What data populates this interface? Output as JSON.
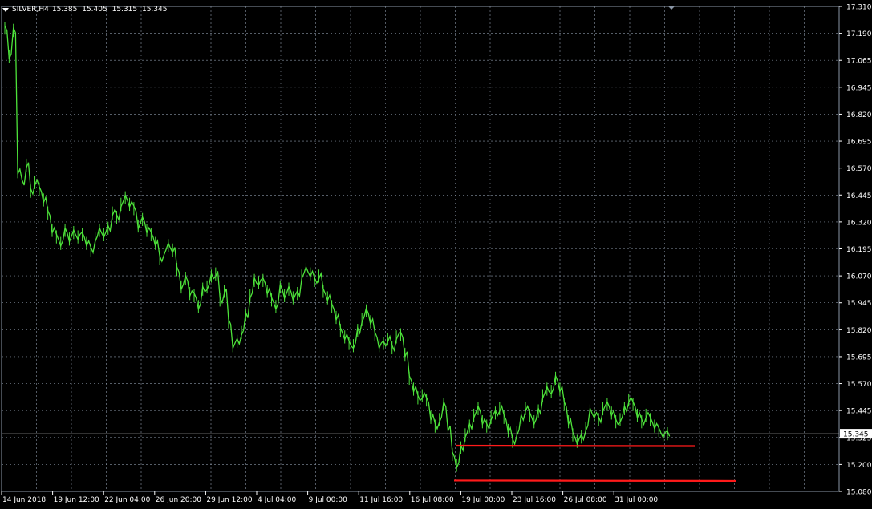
{
  "header": {
    "symbol": "SILVER,H4",
    "open": "15.385",
    "high": "15.405",
    "low": "15.315",
    "close": "15.345"
  },
  "colors": {
    "background": "#000000",
    "grid": "#8a96a6",
    "candle": "#4de33a",
    "text": "#ffffff",
    "support_line": "#ff1a1a"
  },
  "chart_data": {
    "type": "line",
    "series": [
      {
        "values": [
          17.21,
          17.08,
          17.2,
          16.55,
          16.5,
          16.58,
          16.46,
          16.5,
          16.47,
          16.42,
          16.36,
          16.28,
          16.25,
          16.22,
          16.28,
          16.24,
          16.27,
          16.25,
          16.26,
          16.22,
          16.19,
          16.24,
          16.28,
          16.26,
          16.29,
          16.36,
          16.34,
          16.4,
          16.43,
          16.4,
          16.38,
          16.3,
          16.33,
          16.28,
          16.26,
          16.22,
          16.15,
          16.18,
          16.21,
          16.19,
          16.1,
          16.02,
          16.06,
          15.99,
          15.98,
          15.93,
          16.01,
          16.02,
          16.07,
          16.08,
          15.96,
          16.0,
          15.86,
          15.75,
          15.77,
          15.81,
          15.89,
          15.98,
          16.05,
          16.04,
          16.05,
          16.0,
          15.96,
          15.93,
          16.02,
          15.98,
          16.01,
          15.97,
          15.99,
          16.07,
          16.1,
          16.08,
          16.05,
          16.07,
          16.0,
          15.97,
          15.93,
          15.88,
          15.82,
          15.79,
          15.76,
          15.75,
          15.82,
          15.87,
          15.91,
          15.86,
          15.8,
          15.75,
          15.76,
          15.78,
          15.74,
          15.79,
          15.8,
          15.71,
          15.6,
          15.55,
          15.51,
          15.52,
          15.5,
          15.42,
          15.38,
          15.41,
          15.48,
          15.37,
          15.25,
          15.2,
          15.28,
          15.34,
          15.38,
          15.43,
          15.46,
          15.4,
          15.38,
          15.42,
          15.44,
          15.46,
          15.42,
          15.36,
          15.31,
          15.35,
          15.42,
          15.46,
          15.43,
          15.4,
          15.45,
          15.52,
          15.55,
          15.54,
          15.6,
          15.55,
          15.48,
          15.4,
          15.34,
          15.31,
          15.33,
          15.37,
          15.45,
          15.43,
          15.41,
          15.46,
          15.48,
          15.44,
          15.4,
          15.41,
          15.46,
          15.5,
          15.48,
          15.43,
          15.4,
          15.43,
          15.41,
          15.38,
          15.36,
          15.34,
          15.345
        ]
      }
    ],
    "y_axis_ticks": [
      "17.310",
      "17.190",
      "17.065",
      "16.945",
      "16.820",
      "16.695",
      "16.570",
      "16.445",
      "16.320",
      "16.195",
      "16.070",
      "15.945",
      "15.820",
      "15.695",
      "15.570",
      "15.445",
      "15.325",
      "15.200",
      "15.080"
    ],
    "ylim": [
      15.08,
      17.31
    ],
    "current_price": "15.345",
    "x_axis_labels": [
      "14 Jun 2018",
      "19 Jun 12:00",
      "22 Jun 04:00",
      "26 Jun 20:00",
      "29 Jun 12:00",
      "4 Jul 04:00",
      "9 Jul 00:00",
      "11 Jul 16:00",
      "16 Jul 08:00",
      "19 Jul 00:00",
      "23 Jul 16:00",
      "26 Jul 08:00",
      "31 Jul 00:00"
    ],
    "support_lines": [
      {
        "price": 15.29
      },
      {
        "price": 15.13
      }
    ],
    "grid": true
  }
}
